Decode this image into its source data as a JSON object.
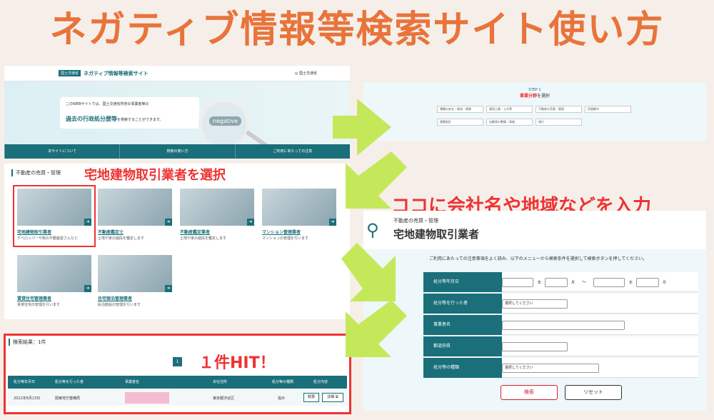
{
  "title": "ネガティブ情報等検索サイト使い方",
  "site": {
    "badge": "国土交通省",
    "name": "ネガティブ情報等検索サイト",
    "ministry": "国土交通省",
    "intro_line1": "このWEBサイトでは、国土交通省所管の事業者等の",
    "intro_highlight": "過去の行政処分歴等",
    "intro_tail": "を検索することができます。",
    "magnifier_label": "negative",
    "nav": [
      "本サイトについて",
      "検索の使い方",
      "ご利用にあたっての注意"
    ]
  },
  "step": {
    "step_label": "STEP 1",
    "caption_highlight": "事業分野",
    "caption_tail": "を選択",
    "options": [
      "運輸の安全・物流・貨物",
      "建設工事・土木等",
      "不動産の売買・管理",
      "民間都市",
      "建築設計",
      "自動車の整備・車検",
      "旅行"
    ]
  },
  "category": {
    "heading": "不動産の売買・管理",
    "callout": "宅地建物取引業者を選択",
    "cards": [
      {
        "name": "宅地建物取引業者",
        "desc": "デベロッパーや街の不動産屋さんなど"
      },
      {
        "name": "不動産鑑定士",
        "desc": "土地や家の値段を鑑定します"
      },
      {
        "name": "不動産鑑定業者",
        "desc": "土地や家の値段を鑑定します"
      },
      {
        "name": "マンション管理業者",
        "desc": "マンションの管理を行います"
      },
      {
        "name": "賃貸住宅管理業者",
        "desc": "賃貸住宅の管理を行います"
      },
      {
        "name": "住宅宿泊管理業者",
        "desc": "民泊施設の管理を行います"
      }
    ]
  },
  "results": {
    "heading": "検索結果：1件",
    "callout": "１件HIT！",
    "page": "1",
    "columns": [
      "処分等年月日",
      "処分等を行った者",
      "事業者名",
      "本社住所",
      "処分等の種類",
      "処分内容"
    ],
    "row": {
      "date": "2021年6月23日",
      "authority": "関東地方整備局",
      "address": "東京都渋谷区",
      "type": "指示",
      "summary_btn": "概要",
      "detail_btn": "詳細"
    }
  },
  "form": {
    "callout": "ココに会社名や地域などを入力",
    "subtitle": "不動産の売買・管理",
    "heading": "宅地建物取引業者",
    "instruction": "ご利用にあたっての注意事項をよく読み、以下のメニューから検索条件を選択して検索ボタンを押してください。",
    "labels": [
      "処分等年月日",
      "処分等を行った者",
      "事業者名",
      "都道府県",
      "処分等の種類"
    ],
    "year": "年",
    "month": "月",
    "tilde": "〜",
    "select_placeholder": "選択してください",
    "search_btn": "検索",
    "reset_btn": "リセット"
  },
  "colors": {
    "accent": "#e8743b",
    "teal": "#1a6f7a",
    "red": "#e33",
    "arrow": "#c5e85a"
  }
}
